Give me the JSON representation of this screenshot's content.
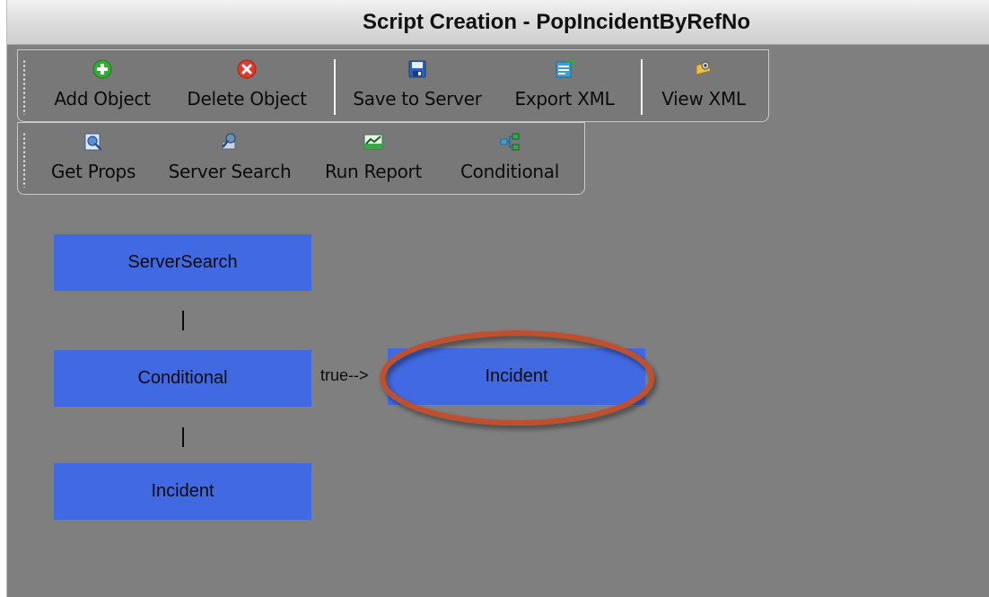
{
  "window": {
    "title": "Script Creation - PopIncidentByRefNo"
  },
  "toolbar_1": {
    "buttons": [
      {
        "label": "Add Object",
        "icon": "add-icon",
        "color": "#2fae2f"
      },
      {
        "label": "Delete Object",
        "icon": "delete-icon",
        "color": "#e03a2a"
      },
      {
        "label": "Save to Server",
        "icon": "save-icon",
        "color": "#2f5fb8"
      },
      {
        "label": "Export XML",
        "icon": "export-xml-icon",
        "color": "#3aa0d8"
      },
      {
        "label": "View XML",
        "icon": "view-xml-icon",
        "color": "#e8c14a"
      }
    ]
  },
  "toolbar_2": {
    "buttons": [
      {
        "label": "Get Props",
        "icon": "get-props-icon",
        "color": "#5a8fd8"
      },
      {
        "label": "Server Search",
        "icon": "server-search-icon",
        "color": "#6f8fb8"
      },
      {
        "label": "Run Report",
        "icon": "run-report-icon",
        "color": "#3aa84a"
      },
      {
        "label": "Conditional",
        "icon": "conditional-icon",
        "color": "#3aa0d8"
      }
    ]
  },
  "canvas": {
    "nodes": {
      "server_search": "ServerSearch",
      "conditional": "Conditional",
      "incident_bottom": "Incident",
      "incident_branch": "Incident"
    },
    "connectors": {
      "vertical_1": "|",
      "vertical_2": "|"
    },
    "branch_label": "true-->",
    "node_color": "#4169e1",
    "highlight_color": "#c0502e"
  }
}
